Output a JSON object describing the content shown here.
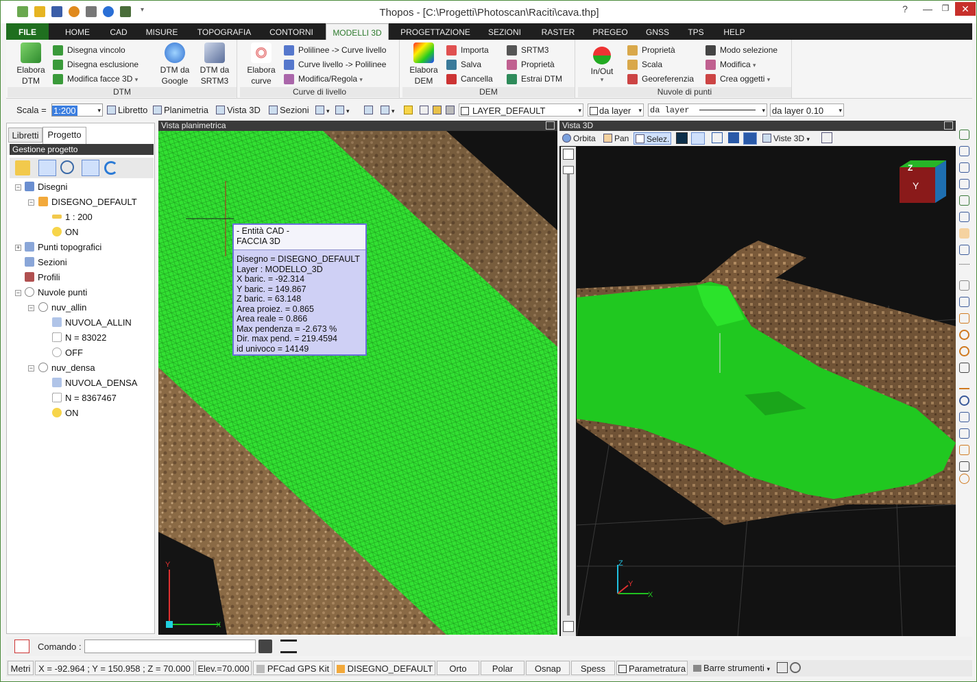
{
  "window": {
    "title": "Thopos - [C:\\Progetti\\Photoscan\\Raciti\\cava.thp]"
  },
  "menu": {
    "file": "FILE",
    "tabs": [
      "HOME",
      "CAD",
      "MISURE",
      "TOPOGRAFIA",
      "CONTORNI",
      "MODELLI 3D",
      "PROGETTAZIONE",
      "SEZIONI",
      "RASTER",
      "PREGEO",
      "GNSS",
      "TPS",
      "HELP"
    ]
  },
  "ribbon": {
    "dtm": {
      "title": "DTM",
      "elabora": [
        "Elabora",
        "DTM"
      ],
      "disegna_vincolo": "Disegna vincolo",
      "disegna_esclusione": "Disegna esclusione",
      "modifica_facce": "Modifica facce 3D",
      "dtm_google": [
        "DTM da",
        "Google"
      ],
      "dtm_srtm3": [
        "DTM da",
        "SRTM3"
      ]
    },
    "curve": {
      "title": "Curve di livello",
      "elabora": [
        "Elabora",
        "curve"
      ],
      "poli_curve": "Polilinee -> Curve livello",
      "curve_poli": "Curve livello -> Polilinee",
      "modifica": "Modifica/Regola"
    },
    "dem": {
      "title": "DEM",
      "elabora": [
        "Elabora",
        "DEM"
      ],
      "importa": "Importa",
      "salva": "Salva",
      "cancella": "Cancella",
      "srtm3": "SRTM3",
      "proprieta": "Proprietà",
      "estrai": "Estrai DTM"
    },
    "nuvole": {
      "title": "Nuvole di punti",
      "inout": "In/Out",
      "proprieta": "Proprietà",
      "scala": "Scala",
      "georef": "Georeferenzia",
      "modo_sel": "Modo selezione",
      "modifica": "Modifica",
      "crea": "Crea oggetti"
    }
  },
  "toolbar": {
    "scala_label": "Scala =",
    "scala_value": "1:200",
    "libretto": "Libretto",
    "planimetria": "Planimetria",
    "vista3d": "Vista 3D",
    "sezioni": "Sezioni",
    "layer": "LAYER_DEFAULT",
    "da_layer": "da layer",
    "da_layer2": "da layer",
    "da_layer3": "da layer 0.10"
  },
  "left": {
    "tabs": [
      "Libretti",
      "Progetto"
    ],
    "header": "Gestione progetto",
    "tree": {
      "disegni": "Disegni",
      "disegno_default": "DISEGNO_DEFAULT",
      "scale": "1 : 200",
      "on1": "ON",
      "punti": "Punti topografici",
      "sezioni": "Sezioni",
      "profili": "Profili",
      "nuvole": "Nuvole punti",
      "nuv_allin": "nuv_allin",
      "nuvola_allin": "NUVOLA_ALLIN",
      "n1": "N = 83022",
      "off": "OFF",
      "nuv_densa": "nuv_densa",
      "nuvola_densa": "NUVOLA_DENSA",
      "n2": "N = 8367467",
      "on2": "ON"
    }
  },
  "plan": {
    "title": "Vista planimetrica",
    "axis_y": "Y",
    "axis_x": "X"
  },
  "tooltip": {
    "line1": "- Entità CAD -",
    "line2": "FACCIA 3D",
    "rows": [
      "Disegno = DISEGNO_DEFAULT",
      "Layer : MODELLO_3D",
      "X baric. = -92.314",
      "Y baric. = 149.867",
      "Z baric. = 63.148",
      "Area proiez. = 0.865",
      "Area reale = 0.866",
      "Max pendenza = -2.673 %",
      "Dir. max pend. = 219.4594",
      "id univoco = 14149"
    ]
  },
  "view3d": {
    "title": "Vista 3D",
    "orbita": "Orbita",
    "pan": "Pan",
    "selez": "Selez.",
    "viste": "Viste 3D",
    "cube_y": "Y",
    "cube_z": "Z",
    "ax_z": "Z",
    "ax_y": "Y",
    "ax_x": "X"
  },
  "command": {
    "label": "Comando :"
  },
  "status": {
    "metri": "Metri",
    "coords": "X = -92.964 ; Y = 150.958 ; Z = 70.000",
    "elev": "Elev.=70.000",
    "gps": "PFCad GPS Kit",
    "disegno": "DISEGNO_DEFAULT",
    "orto": "Orto",
    "polar": "Polar",
    "osnap": "Osnap",
    "spess": "Spess",
    "param": "Parametratura",
    "barre": "Barre strumenti"
  },
  "colors": {
    "accent": "#2c7a2c",
    "mesh": "#2fe02f",
    "tooltip_bg": "#cfd0f5"
  }
}
